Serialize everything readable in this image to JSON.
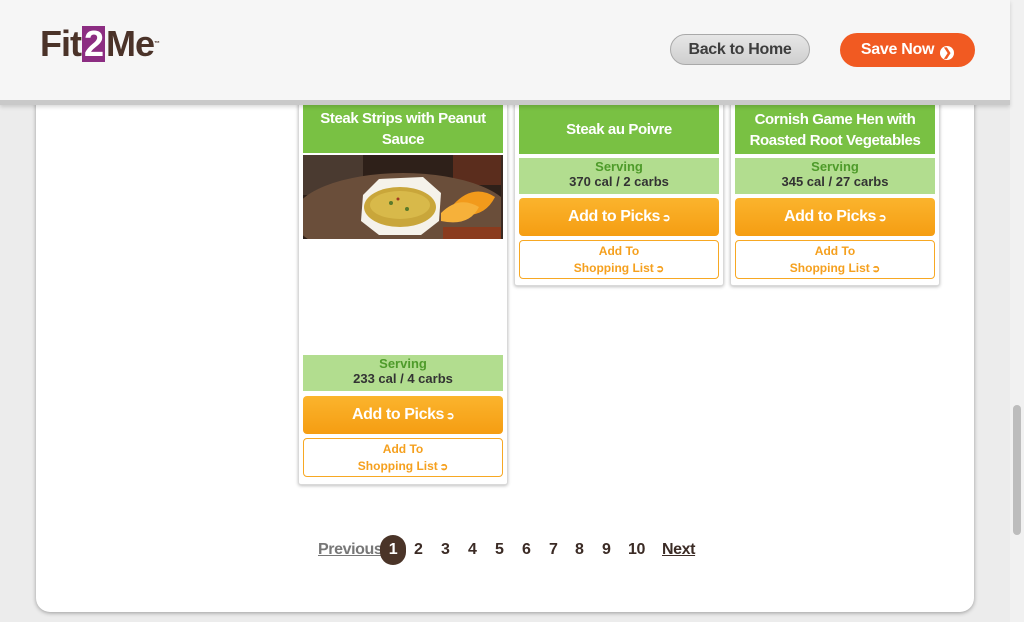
{
  "header": {
    "logo": {
      "part1": "Fit",
      "part2": "2",
      "part3": "Me",
      "tm": "™"
    },
    "back_label": "Back to Home",
    "save_label": "Save Now"
  },
  "cards": [
    {
      "title": "Steak Strips with Peanut Sauce",
      "serving_label": "Serving",
      "serving_value": "233 cal / 4 carbs",
      "picks_label": "Add to Picks",
      "list_line1": "Add To",
      "list_line2": "Shopping List"
    },
    {
      "title": "Steak au Poivre",
      "serving_label": "Serving",
      "serving_value": "370 cal / 2 carbs",
      "picks_label": "Add to Picks",
      "list_line1": "Add To",
      "list_line2": "Shopping List"
    },
    {
      "title": "Cornish Game Hen with Roasted Root Vegetables",
      "serving_label": "Serving",
      "serving_value": "345 cal / 27 carbs",
      "picks_label": "Add to Picks",
      "list_line1": "Add To",
      "list_line2": "Shopping List"
    }
  ],
  "pagination": {
    "previous": "Previous",
    "pages": [
      "1",
      "2",
      "3",
      "4",
      "5",
      "6",
      "7",
      "8",
      "9",
      "10"
    ],
    "current": "1",
    "next": "Next"
  },
  "colors": {
    "brand": "#4b3329",
    "accent": "#8c2d82",
    "save": "#f15a22",
    "green": "#79c143",
    "orange": "#f59d12"
  }
}
